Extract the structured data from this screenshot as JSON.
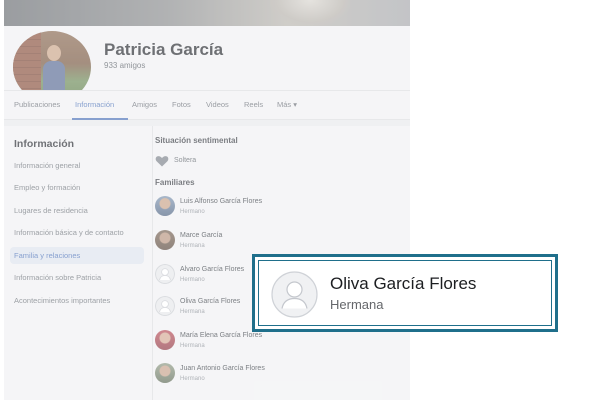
{
  "profile": {
    "name": "Patricia García",
    "friends": "933 amigos"
  },
  "tabs": [
    {
      "label": "Publicaciones"
    },
    {
      "label": "Información"
    },
    {
      "label": "Amigos"
    },
    {
      "label": "Fotos"
    },
    {
      "label": "Videos"
    },
    {
      "label": "Reels"
    },
    {
      "label": "Más ▾"
    }
  ],
  "active_tab": "Información",
  "sidebar": {
    "title": "Información",
    "items": [
      {
        "label": "Información general"
      },
      {
        "label": "Empleo y formación"
      },
      {
        "label": "Lugares de residencia"
      },
      {
        "label": "Información básica y de contacto"
      },
      {
        "label": "Familia y relaciones"
      },
      {
        "label": "Información sobre Patricia"
      },
      {
        "label": "Acontecimientos importantes"
      }
    ],
    "active": "Familia y relaciones"
  },
  "relationship": {
    "heading": "Situación sentimental",
    "status": "Soltera"
  },
  "family": {
    "heading": "Familiares",
    "members": [
      {
        "name": "Luis Alfonso García Flores",
        "relation": "Hermano"
      },
      {
        "name": "Marce García",
        "relation": "Hermana"
      },
      {
        "name": "Alvaro García Flores",
        "relation": "Hermano"
      },
      {
        "name": "Oliva García Flores",
        "relation": "Hermana"
      },
      {
        "name": "María Elena García Flores",
        "relation": "Hermana"
      },
      {
        "name": "Juan Antonio García Flores",
        "relation": "Hermano"
      }
    ]
  },
  "callout": {
    "name": "Oliva García Flores",
    "relation": "Hermana"
  },
  "colors": {
    "accent": "#4e73b8",
    "callout_border": "#1f6f8b"
  },
  "icons": {
    "relationship": "heart-icon",
    "default_avatar": "default-avatar-icon"
  }
}
